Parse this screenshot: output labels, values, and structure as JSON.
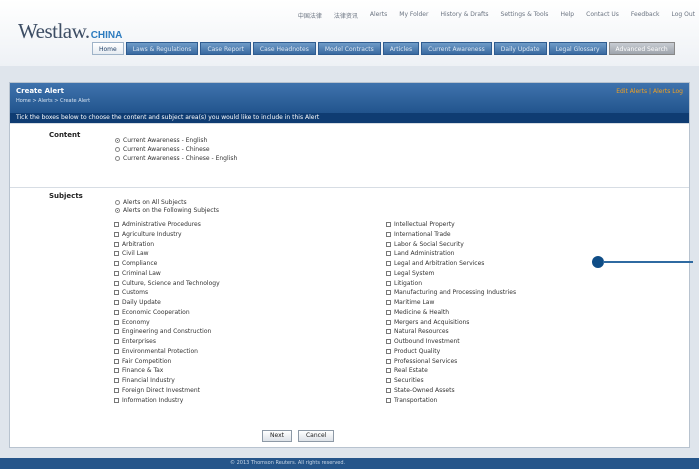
{
  "header": {
    "logo_main": "Westlaw.",
    "logo_suffix": "CHINA",
    "util_links": [
      "中国法律",
      "法律资讯",
      "Alerts",
      "My Folder",
      "History & Drafts",
      "Settings & Tools",
      "Help",
      "Contact Us",
      "Feedback",
      "Log Out"
    ],
    "nav_tabs": [
      {
        "label": "Home",
        "active": true
      },
      {
        "label": "Laws & Regulations"
      },
      {
        "label": "Case Report"
      },
      {
        "label": "Case Headnotes"
      },
      {
        "label": "Model Contracts"
      },
      {
        "label": "Articles"
      },
      {
        "label": "Current Awareness"
      },
      {
        "label": "Daily Update"
      },
      {
        "label": "Legal Glossary"
      },
      {
        "label": "Advanced Search",
        "search": true
      }
    ]
  },
  "page": {
    "title": "Create Alert",
    "breadcrumb": "Home > Alerts > Create Alert",
    "top_links": "Edit Alerts | Alerts Log",
    "instruction": "Tick the boxes below to choose the content and subject area(s) you would like to include in this Alert"
  },
  "content_section": {
    "label": "Content",
    "options": [
      {
        "label": "Current Awareness - English",
        "selected": true
      },
      {
        "label": "Current Awareness - Chinese",
        "selected": false
      },
      {
        "label": "Current Awareness - Chinese - English",
        "selected": false
      }
    ]
  },
  "subjects_section": {
    "label": "Subjects",
    "scope_options": [
      {
        "label": "Alerts on All Subjects",
        "selected": false
      },
      {
        "label": "Alerts on the Following Subjects",
        "selected": true
      }
    ],
    "left_column": [
      "Administrative Procedures",
      "Agriculture Industry",
      "Arbitration",
      "Civil Law",
      "Compliance",
      "Criminal Law",
      "Culture, Science and Technology",
      "Customs",
      "Daily Update",
      "Economic Cooperation",
      "Economy",
      "Engineering and Construction",
      "Enterprises",
      "Environmental Protection",
      "Fair Competition",
      "Finance & Tax",
      "Financial Industry",
      "Foreign Direct Investment",
      "Information Industry"
    ],
    "right_column": [
      "Intellectual Property",
      "International Trade",
      "Labor & Social Security",
      "Land Administration",
      "Legal and Arbitration Services",
      "Legal System",
      "Litigation",
      "Manufacturing and Processing Industries",
      "Maritime Law",
      "Medicine & Health",
      "Mergers and Acquisitions",
      "Natural Resources",
      "Outbound Investment",
      "Product Quality",
      "Professional Services",
      "Real Estate",
      "Securities",
      "State-Owned Assets",
      "Transportation"
    ]
  },
  "buttons": {
    "next": "Next",
    "cancel": "Cancel"
  },
  "footer": {
    "text": "© 2013 Thomson Reuters. All rights reserved."
  }
}
